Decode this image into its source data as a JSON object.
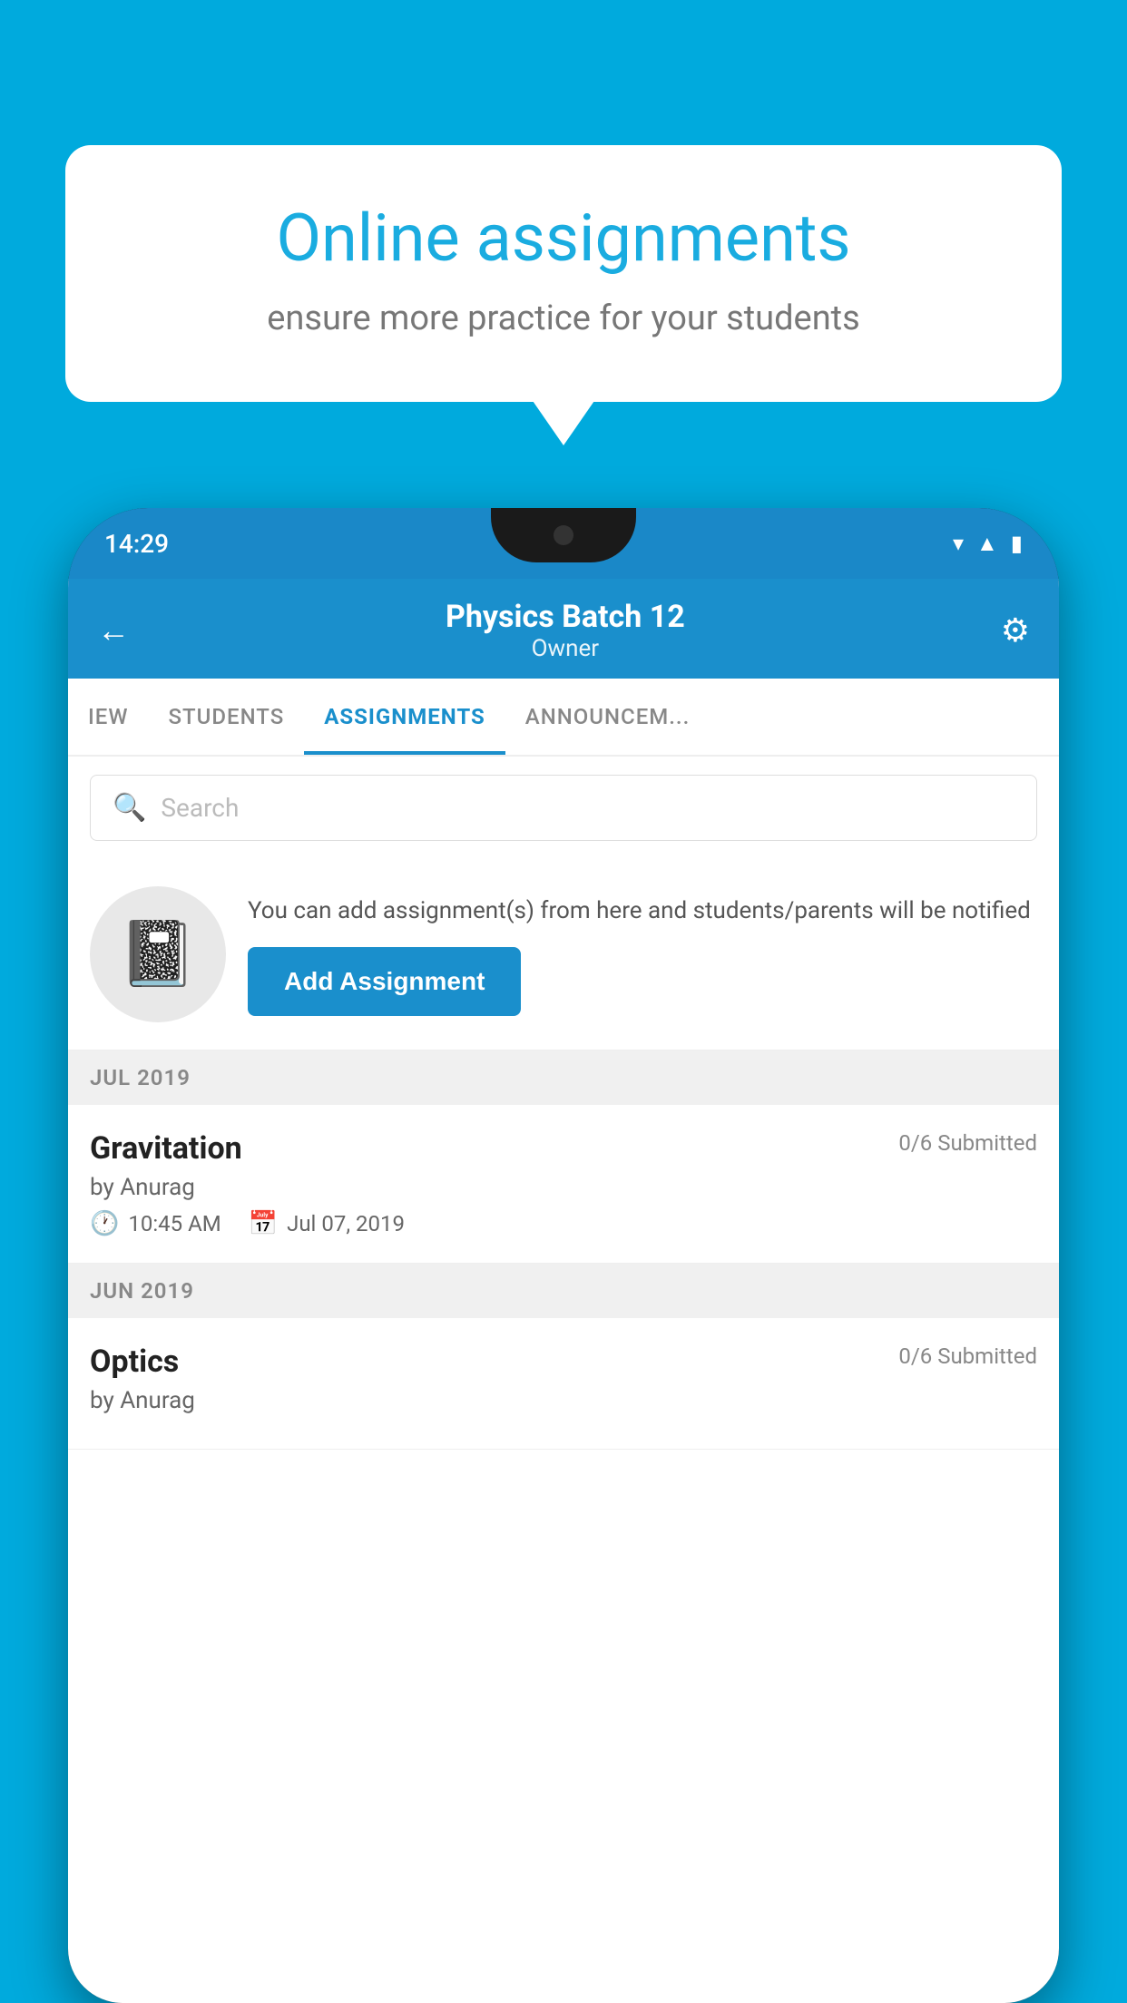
{
  "background_color": "#00AADD",
  "promo": {
    "title": "Online assignments",
    "subtitle": "ensure more practice for your students"
  },
  "phone": {
    "status_bar": {
      "time": "14:29",
      "icons": [
        "wifi",
        "signal",
        "battery"
      ]
    },
    "header": {
      "title": "Physics Batch 12",
      "subtitle": "Owner",
      "back_icon": "←",
      "settings_icon": "⚙"
    },
    "tabs": [
      {
        "label": "IEW",
        "active": false
      },
      {
        "label": "STUDENTS",
        "active": false
      },
      {
        "label": "ASSIGNMENTS",
        "active": true
      },
      {
        "label": "ANNOUNCEM...",
        "active": false
      }
    ],
    "search": {
      "placeholder": "Search"
    },
    "add_assignment_section": {
      "info_text": "You can add assignment(s) from here and students/parents will be notified",
      "button_label": "Add Assignment"
    },
    "sections": [
      {
        "month": "JUL 2019",
        "assignments": [
          {
            "name": "Gravitation",
            "submitted": "0/6 Submitted",
            "by": "by Anurag",
            "time": "10:45 AM",
            "date": "Jul 07, 2019"
          }
        ]
      },
      {
        "month": "JUN 2019",
        "assignments": [
          {
            "name": "Optics",
            "submitted": "0/6 Submitted",
            "by": "by Anurag",
            "time": "",
            "date": ""
          }
        ]
      }
    ]
  }
}
